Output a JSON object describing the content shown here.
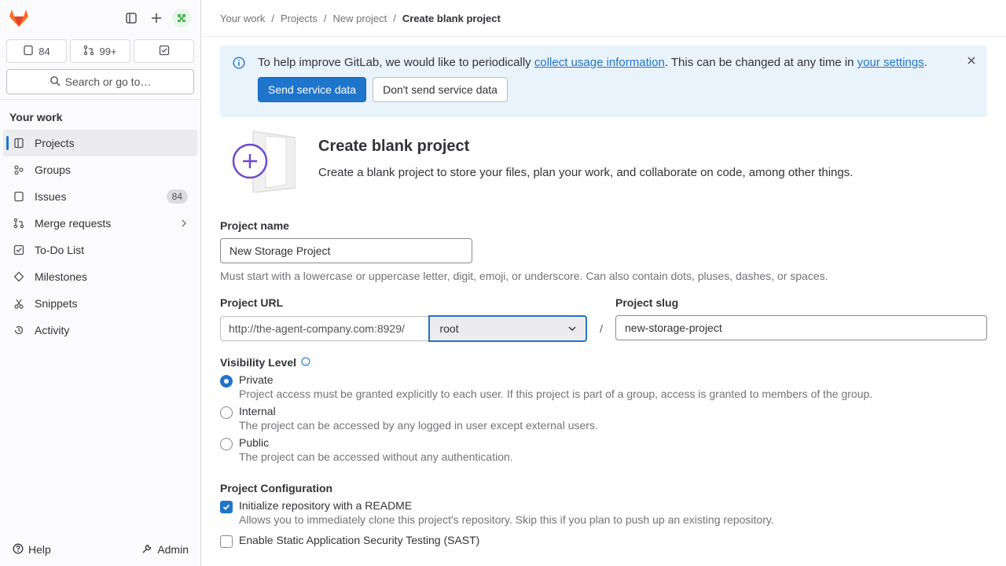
{
  "sidebar": {
    "counts": {
      "issues": "84",
      "merge_requests": "99+"
    },
    "search_label": "Search or go to…",
    "section_title": "Your work",
    "items": [
      {
        "label": "Projects"
      },
      {
        "label": "Groups"
      },
      {
        "label": "Issues",
        "badge": "84"
      },
      {
        "label": "Merge requests"
      },
      {
        "label": "To-Do List"
      },
      {
        "label": "Milestones"
      },
      {
        "label": "Snippets"
      },
      {
        "label": "Activity"
      }
    ],
    "help_label": "Help",
    "admin_label": "Admin"
  },
  "breadcrumb": [
    "Your work",
    "Projects",
    "New project",
    "Create blank project"
  ],
  "banner": {
    "text_before": "To help improve GitLab, we would like to periodically",
    "link1": "collect usage information",
    "text_middle": ". This can be changed at any time in",
    "link2": "your settings",
    "text_after": ".",
    "send_label": "Send service data",
    "dont_send_label": "Don't send service data"
  },
  "header": {
    "title": "Create blank project",
    "description": "Create a blank project to store your files, plan your work, and collaborate on code, among other things."
  },
  "form": {
    "project_name_label": "Project name",
    "project_name_value": "New Storage Project",
    "project_name_help": "Must start with a lowercase or uppercase letter, digit, emoji, or underscore. Can also contain dots, pluses, dashes, or spaces.",
    "project_url_label": "Project URL",
    "project_url_prefix": "http://the-agent-company.com:8929/",
    "namespace_value": "root",
    "slash": "/",
    "project_slug_label": "Project slug",
    "project_slug_value": "new-storage-project",
    "visibility_label": "Visibility Level",
    "visibility_options": [
      {
        "title": "Private",
        "desc": "Project access must be granted explicitly to each user. If this project is part of a group, access is granted to members of the group."
      },
      {
        "title": "Internal",
        "desc": "The project can be accessed by any logged in user except external users."
      },
      {
        "title": "Public",
        "desc": "The project can be accessed without any authentication."
      }
    ],
    "config_label": "Project Configuration",
    "readme_title": "Initialize repository with a README",
    "readme_desc": "Allows you to immediately clone this project's repository. Skip this if you plan to push up an existing repository.",
    "sast_title": "Enable Static Application Security Testing (SAST)"
  },
  "colors": {
    "accent": "#1f75cb",
    "banner_bg": "#e9f3fc",
    "sidebar_bg": "#fbfafd"
  }
}
